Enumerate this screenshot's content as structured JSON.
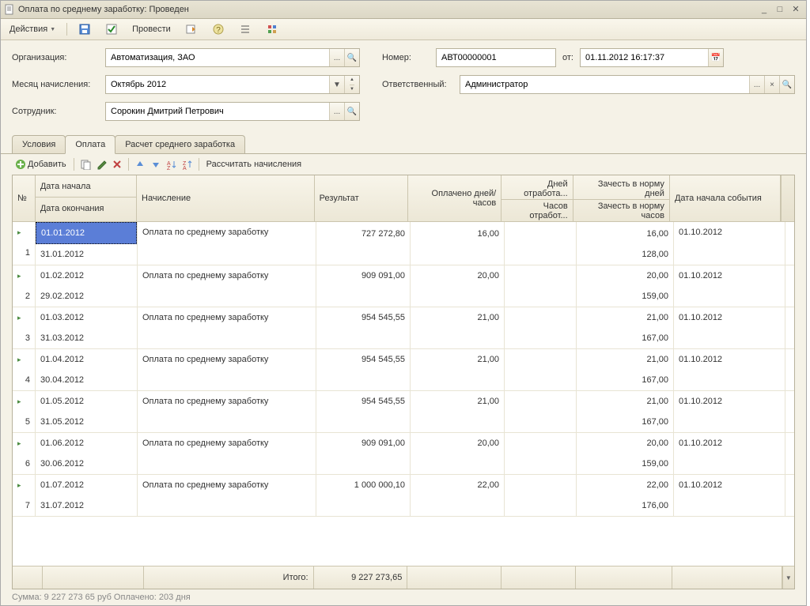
{
  "window": {
    "title": "Оплата по среднему заработку: Проведен"
  },
  "toolbar": {
    "actions": "Действия",
    "post": "Провести"
  },
  "form": {
    "org_label": "Организация:",
    "org_value": "Автоматизация, ЗАО",
    "month_label": "Месяц начисления:",
    "month_value": "Октябрь 2012",
    "emp_label": "Сотрудник:",
    "emp_value": "Сорокин Дмитрий Петрович",
    "num_label": "Номер:",
    "num_value": "АВТ00000001",
    "ot_label": "от:",
    "ot_value": "01.11.2012 16:17:37",
    "resp_label": "Ответственный:",
    "resp_value": "Администратор"
  },
  "tabs": {
    "t1": "Условия",
    "t2": "Оплата",
    "t3": "Расчет среднего заработка"
  },
  "subtoolbar": {
    "add": "Добавить",
    "calc": "Рассчитать начисления"
  },
  "headers": {
    "num": "№",
    "date_start": "Дата начала",
    "date_end": "Дата окончания",
    "nach": "Начисление",
    "result": "Результат",
    "paid": "Оплачено дней/часов",
    "days_worked": "Дней отработа...",
    "hours_worked": "Часов отработ...",
    "norm_days": "Зачесть в норму дней",
    "norm_hours": "Зачесть в норму часов",
    "event_start": "Дата начала события"
  },
  "rows": [
    {
      "n": "1",
      "ds": "01.01.2012",
      "de": "31.01.2012",
      "nach": "Оплата по среднему заработку",
      "res": "727 272,80",
      "paid": "16,00",
      "nd": "16,00",
      "nh": "128,00",
      "ev": "01.10.2012"
    },
    {
      "n": "2",
      "ds": "01.02.2012",
      "de": "29.02.2012",
      "nach": "Оплата по среднему заработку",
      "res": "909 091,00",
      "paid": "20,00",
      "nd": "20,00",
      "nh": "159,00",
      "ev": "01.10.2012"
    },
    {
      "n": "3",
      "ds": "01.03.2012",
      "de": "31.03.2012",
      "nach": "Оплата по среднему заработку",
      "res": "954 545,55",
      "paid": "21,00",
      "nd": "21,00",
      "nh": "167,00",
      "ev": "01.10.2012"
    },
    {
      "n": "4",
      "ds": "01.04.2012",
      "de": "30.04.2012",
      "nach": "Оплата по среднему заработку",
      "res": "954 545,55",
      "paid": "21,00",
      "nd": "21,00",
      "nh": "167,00",
      "ev": "01.10.2012"
    },
    {
      "n": "5",
      "ds": "01.05.2012",
      "de": "31.05.2012",
      "nach": "Оплата по среднему заработку",
      "res": "954 545,55",
      "paid": "21,00",
      "nd": "21,00",
      "nh": "167,00",
      "ev": "01.10.2012"
    },
    {
      "n": "6",
      "ds": "01.06.2012",
      "de": "30.06.2012",
      "nach": "Оплата по среднему заработку",
      "res": "909 091,00",
      "paid": "20,00",
      "nd": "20,00",
      "nh": "159,00",
      "ev": "01.10.2012"
    },
    {
      "n": "7",
      "ds": "01.07.2012",
      "de": "31.07.2012",
      "nach": "Оплата по среднему заработку",
      "res": "1 000 000,10",
      "paid": "22,00",
      "nd": "22,00",
      "nh": "176,00",
      "ev": "01.10.2012"
    }
  ],
  "footer": {
    "total_label": "Итого:",
    "total_value": "9 227 273,65"
  },
  "status": "Сумма: 9 227 273 65 руб  Оплачено: 203 дня"
}
